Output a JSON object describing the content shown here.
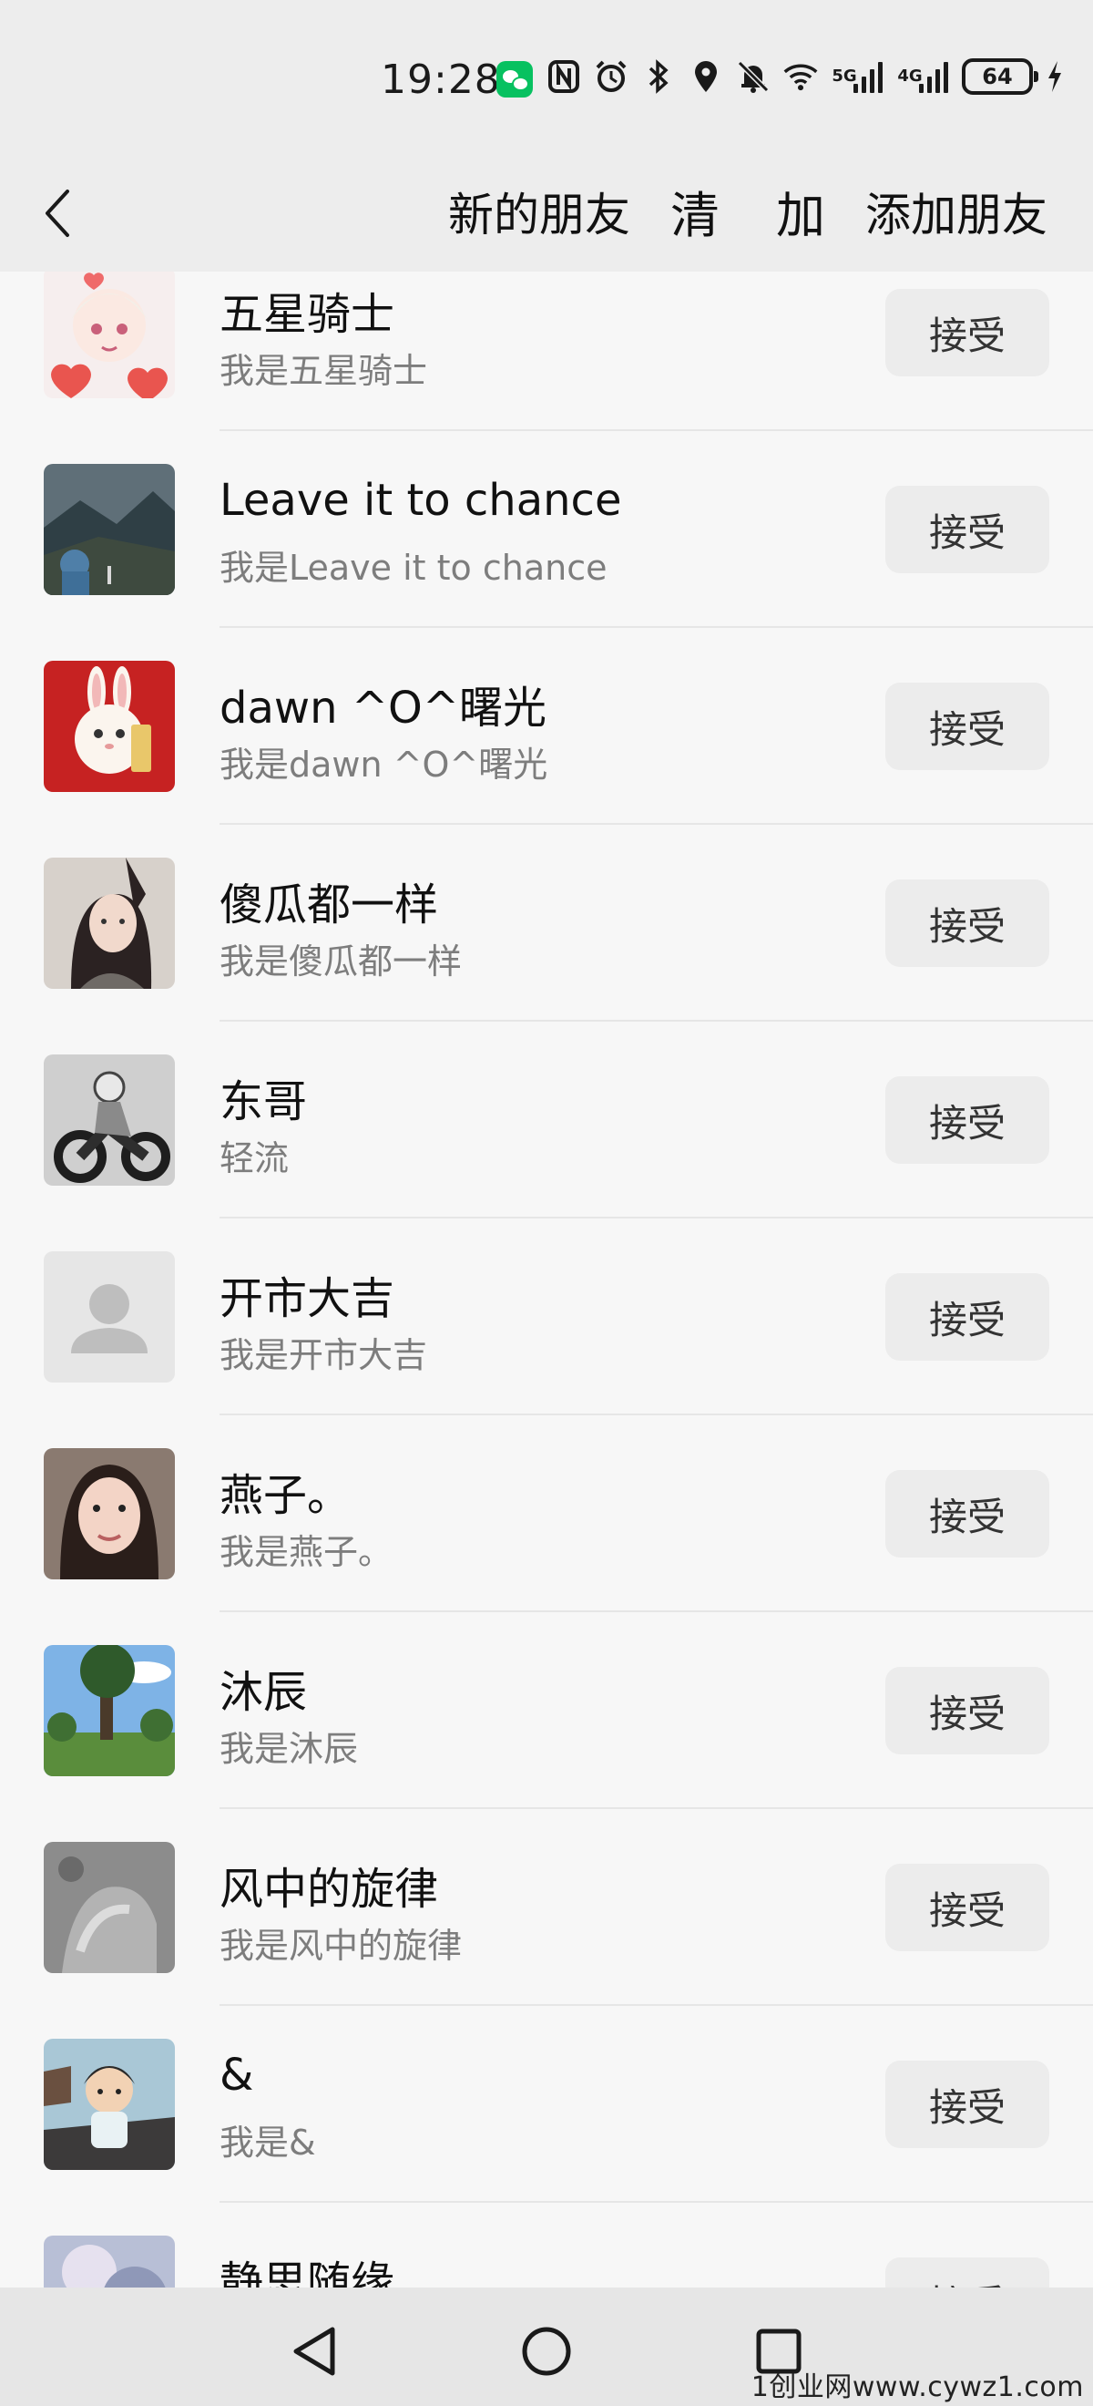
{
  "status_bar": {
    "time": "19:28",
    "battery": "64",
    "icons": [
      "wechat-icon",
      "nfc-icon",
      "alarm-icon",
      "bluetooth-icon",
      "location-icon",
      "mute-icon",
      "wifi-icon",
      "signal-5g-icon",
      "signal-4g-icon",
      "battery-icon",
      "charging-icon"
    ],
    "net1": "5G",
    "net2": "4G"
  },
  "header": {
    "back_icon": "chevron-left-icon",
    "title": "新的朋友",
    "clear": "清",
    "add": "加",
    "add_friend": "添加朋友"
  },
  "requests": [
    {
      "name": "五星骑士",
      "message": "我是五星骑士",
      "action": "接受",
      "avatar": "anime-girl-hearts"
    },
    {
      "name": "Leave it to chance",
      "message": "我是Leave it to chance",
      "action": "接受",
      "avatar": "mountain-landscape"
    },
    {
      "name": "dawn ^O^曙光",
      "message": "我是dawn ^O^曙光",
      "action": "接受",
      "avatar": "white-rabbit-red"
    },
    {
      "name": "傻瓜都一样",
      "message": "我是傻瓜都一样",
      "action": "接受",
      "avatar": "girl-portrait"
    },
    {
      "name": "东哥",
      "message": "轻流",
      "action": "接受",
      "avatar": "motorcycle-rider"
    },
    {
      "name": "开市大吉",
      "message": "我是开市大吉",
      "action": "接受",
      "avatar": "default-person"
    },
    {
      "name": "燕子。",
      "message": "我是燕子。",
      "action": "接受",
      "avatar": "woman-selfie"
    },
    {
      "name": "沐辰",
      "message": "我是沐辰",
      "action": "接受",
      "avatar": "tree-sky"
    },
    {
      "name": "风中的旋律",
      "message": "我是风中的旋律",
      "action": "接受",
      "avatar": "grey-hands"
    },
    {
      "name": "&",
      "message": "我是&",
      "action": "接受",
      "avatar": "cartoon-boy"
    },
    {
      "name": "静思随缘",
      "message": "",
      "action": "接受",
      "avatar": "blurred-photo"
    }
  ],
  "bottom_nav": {
    "back": "triangle-back-icon",
    "home": "circle-home-icon",
    "recents": "square-recents-icon"
  },
  "watermark": "1创业网www.cywz1.com"
}
